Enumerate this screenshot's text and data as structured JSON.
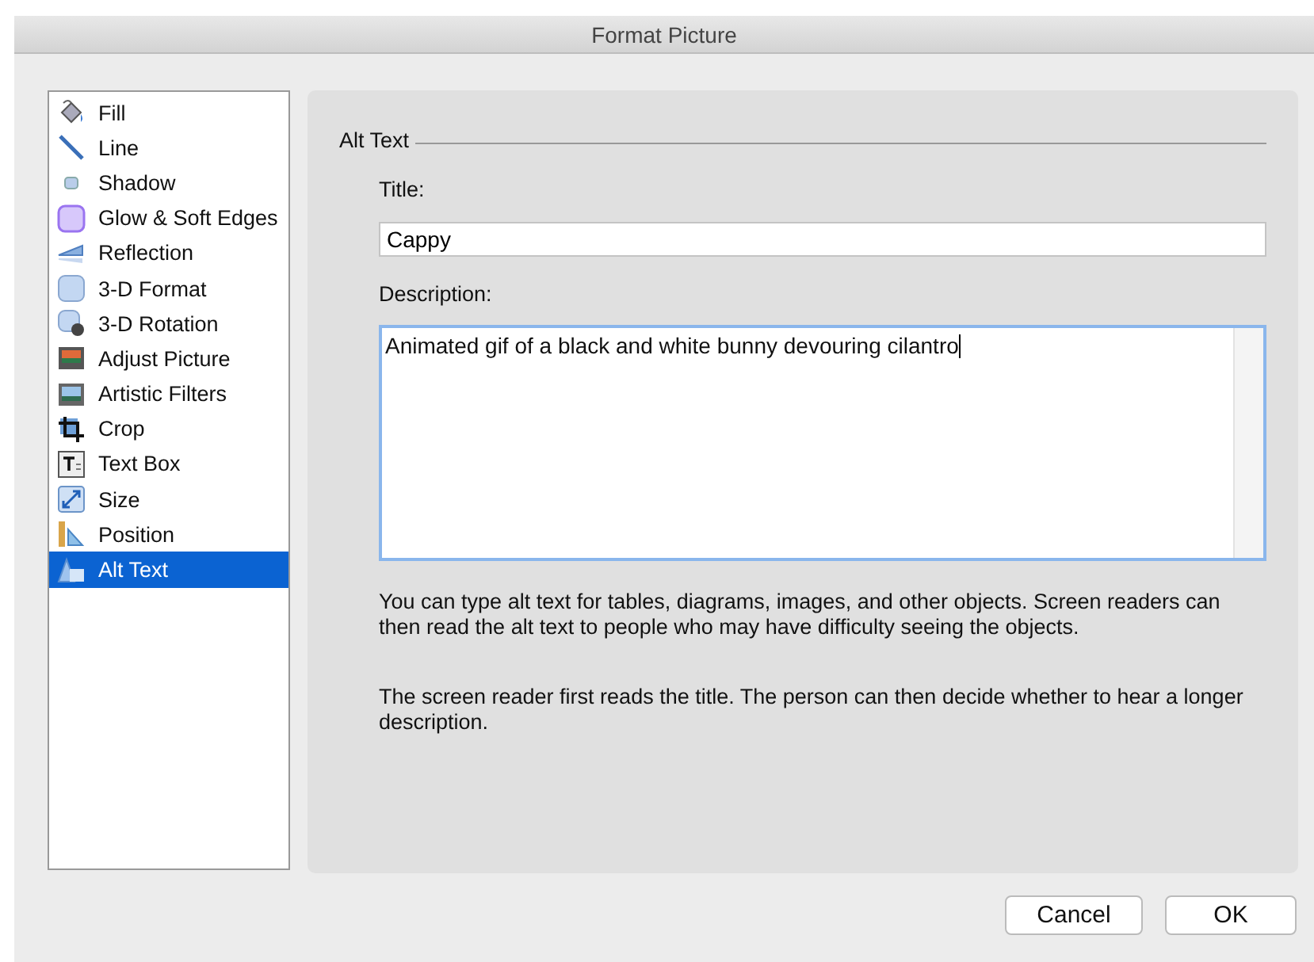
{
  "window": {
    "title": "Format Picture"
  },
  "sidebar": {
    "items": [
      {
        "label": "Fill",
        "selected": false
      },
      {
        "label": "Line",
        "selected": false
      },
      {
        "label": "Shadow",
        "selected": false
      },
      {
        "label": "Glow & Soft Edges",
        "selected": false
      },
      {
        "label": "Reflection",
        "selected": false
      },
      {
        "label": "3-D Format",
        "selected": false
      },
      {
        "label": "3-D Rotation",
        "selected": false
      },
      {
        "label": "Adjust Picture",
        "selected": false
      },
      {
        "label": "Artistic Filters",
        "selected": false
      },
      {
        "label": "Crop",
        "selected": false
      },
      {
        "label": "Text Box",
        "selected": false
      },
      {
        "label": "Size",
        "selected": false
      },
      {
        "label": "Position",
        "selected": false
      },
      {
        "label": "Alt Text",
        "selected": true
      }
    ]
  },
  "panel": {
    "heading": "Alt Text",
    "title_label": "Title:",
    "title_value": "Cappy",
    "description_label": "Description:",
    "description_value": "Animated gif of a black and white bunny devouring cilantro",
    "help": [
      "You can type alt text for tables, diagrams, images, and other objects. Screen readers can then read the alt text to people who may have difficulty seeing the objects.",
      "The screen reader first reads the title. The person can then decide whether to hear a longer description."
    ]
  },
  "buttons": [
    "Cancel",
    "OK"
  ]
}
